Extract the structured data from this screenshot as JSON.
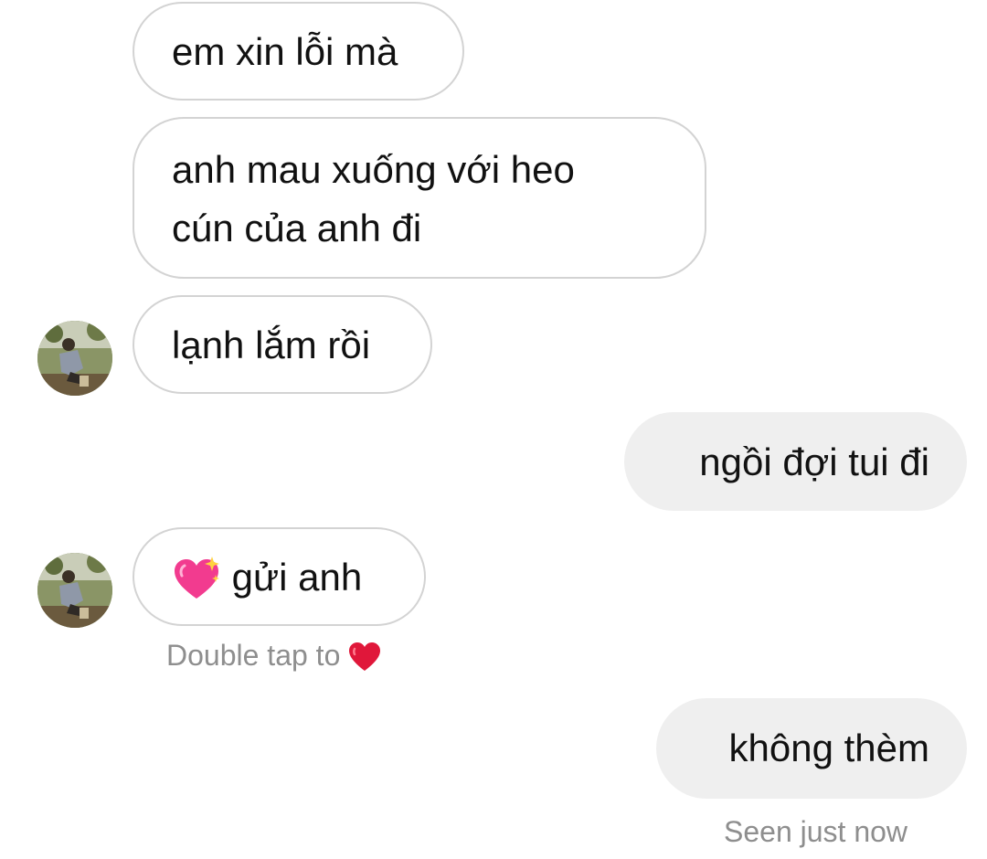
{
  "thread": {
    "messages": [
      {
        "id": "m1",
        "sender": "other",
        "text": "em xin lỗi mà"
      },
      {
        "id": "m2",
        "sender": "other",
        "lines": [
          "anh mau xuống với heo",
          "cún của anh đi"
        ]
      },
      {
        "id": "m3",
        "sender": "other",
        "text": "lạnh lắm rồi",
        "show_avatar": true
      },
      {
        "id": "m4",
        "sender": "me",
        "text": "ngồi đợi tui đi"
      },
      {
        "id": "m5",
        "sender": "other",
        "emoji": "sparkling-heart-icon",
        "text": "gửi anh",
        "show_avatar": true
      },
      {
        "id": "m6",
        "sender": "me",
        "text": "không thèm"
      }
    ],
    "double_tap_hint": "Double tap to",
    "double_tap_icon": "red-heart-icon",
    "seen_status": "Seen just now"
  },
  "colors": {
    "incoming_bubble_border": "#d3d3d3",
    "outgoing_bubble_bg": "#efefef",
    "meta_text": "#8e8e8e",
    "heart_red": "#e0173a"
  }
}
